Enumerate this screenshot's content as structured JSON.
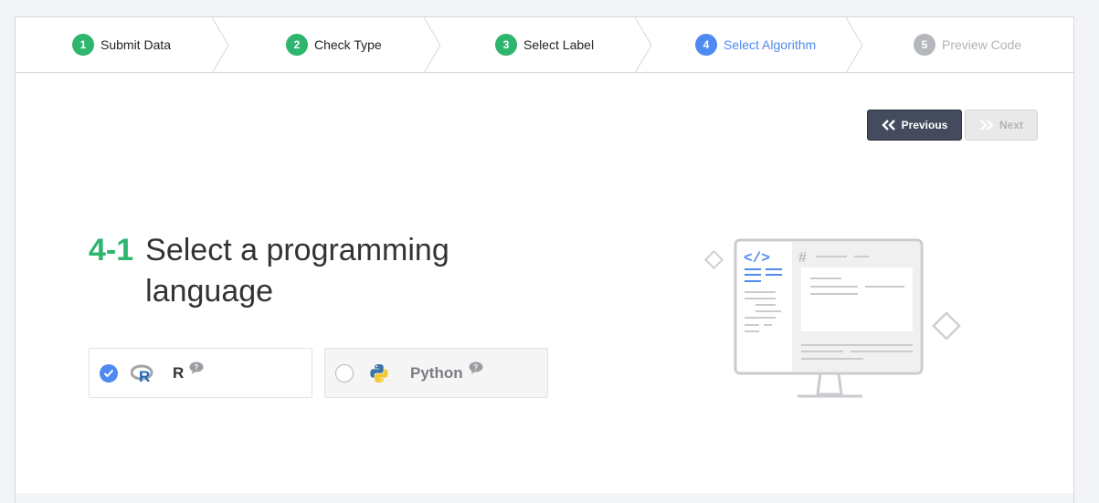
{
  "stepper": {
    "steps": [
      {
        "num": "1",
        "label": "Submit Data",
        "state": "done"
      },
      {
        "num": "2",
        "label": "Check Type",
        "state": "done"
      },
      {
        "num": "3",
        "label": "Select Label",
        "state": "done"
      },
      {
        "num": "4",
        "label": "Select Algorithm",
        "state": "active"
      },
      {
        "num": "5",
        "label": "Preview Code",
        "state": "todo"
      }
    ]
  },
  "nav": {
    "previous_label": "Previous",
    "next_label": "Next"
  },
  "section": {
    "number": "4-1",
    "title": "Select a programming language"
  },
  "options": [
    {
      "label": "R",
      "selected": true,
      "icon": "r-logo-icon"
    },
    {
      "label": "Python",
      "selected": false,
      "icon": "python-logo-icon"
    }
  ],
  "illustration": {
    "code_symbol": "</>",
    "hash_symbol": "#"
  },
  "colors": {
    "success": "#2eb56e",
    "active": "#4e8af0",
    "inactive": "#b4b7bc",
    "dark_button": "#434b5c"
  }
}
